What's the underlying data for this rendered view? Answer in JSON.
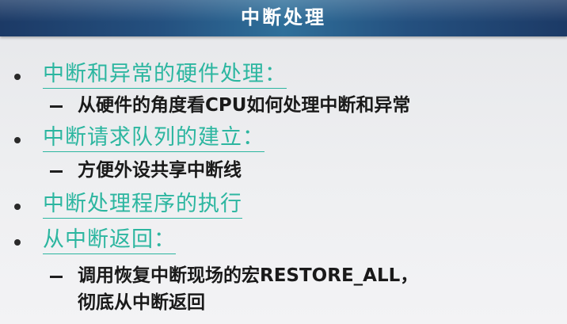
{
  "slide": {
    "title": "中断处理",
    "items": [
      {
        "text": "中断和异常的硬件处理：",
        "sub": [
          "从硬件的角度看CPU如何处理中断和异常"
        ]
      },
      {
        "text": "中断请求队列的建立：",
        "sub": [
          "方便外设共享中断线"
        ]
      },
      {
        "text": "中断处理程序的执行",
        "sub": []
      },
      {
        "text": "从中断返回：",
        "sub": [
          "调用恢复中断现场的宏RESTORE_ALL，",
          "彻底从中断返回"
        ]
      }
    ]
  },
  "colors": {
    "title_bar": "#24507f",
    "title_text": "#ffffff",
    "level1_text": "#2cb6a0",
    "level2_text": "#1a1a1a",
    "background": "#eeeff1"
  }
}
